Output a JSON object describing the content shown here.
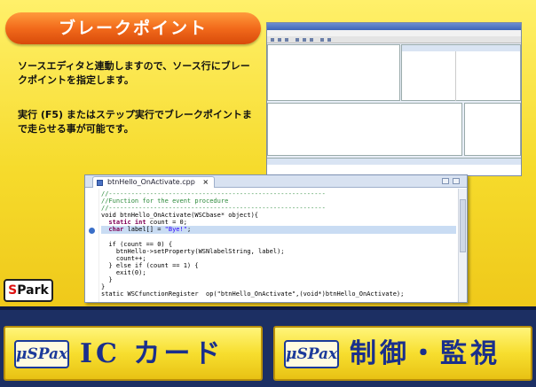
{
  "title": "ブレークポイント",
  "description": {
    "para1": "ソースエディタと連動しますので、ソース行にブレークポイントを指定します。",
    "para2": "実行 (F5) またはステップ実行でブレークポイントまで走らせる事が可能です。"
  },
  "editor": {
    "tab_label": "btnHello_OnActivate.cpp",
    "close_glyph": "×",
    "code": {
      "l1": "//----------------------------------------------------------",
      "l2": "//Function for the event procedure",
      "l3": "//----------------------------------------------------------",
      "l4": "void btnHello_OnActivate(WSCbase* object){",
      "l5a": "  static int",
      "l5b": " count = 0;",
      "l6a": "  char",
      "l6b": " label[] = ",
      "l6c": "\"Bye!\"",
      "l6d": ";",
      "l7": "",
      "l8": "  if (count == 0) {",
      "l9": "    btnHello->setProperty(WSNlabelString, label);",
      "l10": "    count++;",
      "l11": "  } else if (count == 1) {",
      "l12": "    exit(0);",
      "l13": "  }",
      "l14": "}",
      "l15": "static WSCfunctionRegister  op(\"btnHello_OnActivate\",(void*)btnHello_OnActivate);"
    }
  },
  "logo_spark": {
    "s": "S",
    "rest": "Park"
  },
  "buttons": [
    {
      "logo": "μSPax",
      "label": "IC カード"
    },
    {
      "logo": "μSPax",
      "label": "制御・監視"
    }
  ]
}
